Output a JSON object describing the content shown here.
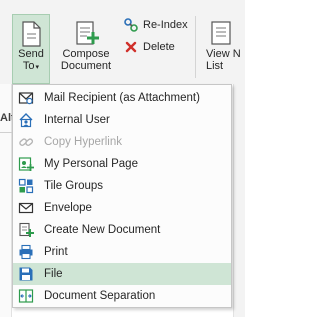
{
  "ribbon": {
    "send_to": {
      "line1": "Send",
      "line2": "To",
      "caret": "▾"
    },
    "compose": {
      "line1": "Compose",
      "line2": "Document"
    },
    "reindex_label": "Re-Index",
    "delete_label": "Delete",
    "view_next": {
      "line1": "View N",
      "line2": "List"
    },
    "left_strip_text": "Alt"
  },
  "menu": {
    "items": [
      {
        "label": "Mail Recipient (as Attachment)",
        "icon": "mail-attachment-icon",
        "enabled": true,
        "highlighted": false
      },
      {
        "label": "Internal User",
        "icon": "internal-user-icon",
        "enabled": true,
        "highlighted": false
      },
      {
        "label": "Copy Hyperlink",
        "icon": "hyperlink-icon",
        "enabled": false,
        "highlighted": false
      },
      {
        "label": "My Personal Page",
        "icon": "personal-page-icon",
        "enabled": true,
        "highlighted": false
      },
      {
        "label": "Tile Groups",
        "icon": "tile-groups-icon",
        "enabled": true,
        "highlighted": false
      },
      {
        "label": "Envelope",
        "icon": "envelope-icon",
        "enabled": true,
        "highlighted": false
      },
      {
        "label": "Create New Document",
        "icon": "new-document-icon",
        "enabled": true,
        "highlighted": false
      },
      {
        "label": "Print",
        "icon": "printer-icon",
        "enabled": true,
        "highlighted": false
      },
      {
        "label": "File",
        "icon": "save-file-icon",
        "enabled": true,
        "highlighted": true
      },
      {
        "label": "Document Separation",
        "icon": "document-separation-icon",
        "enabled": true,
        "highlighted": false
      }
    ]
  },
  "colors": {
    "highlight": "#cfe5d5",
    "accent_green": "#2e9b4d",
    "accent_blue": "#2a6fb8",
    "delete_red": "#d0302a"
  }
}
